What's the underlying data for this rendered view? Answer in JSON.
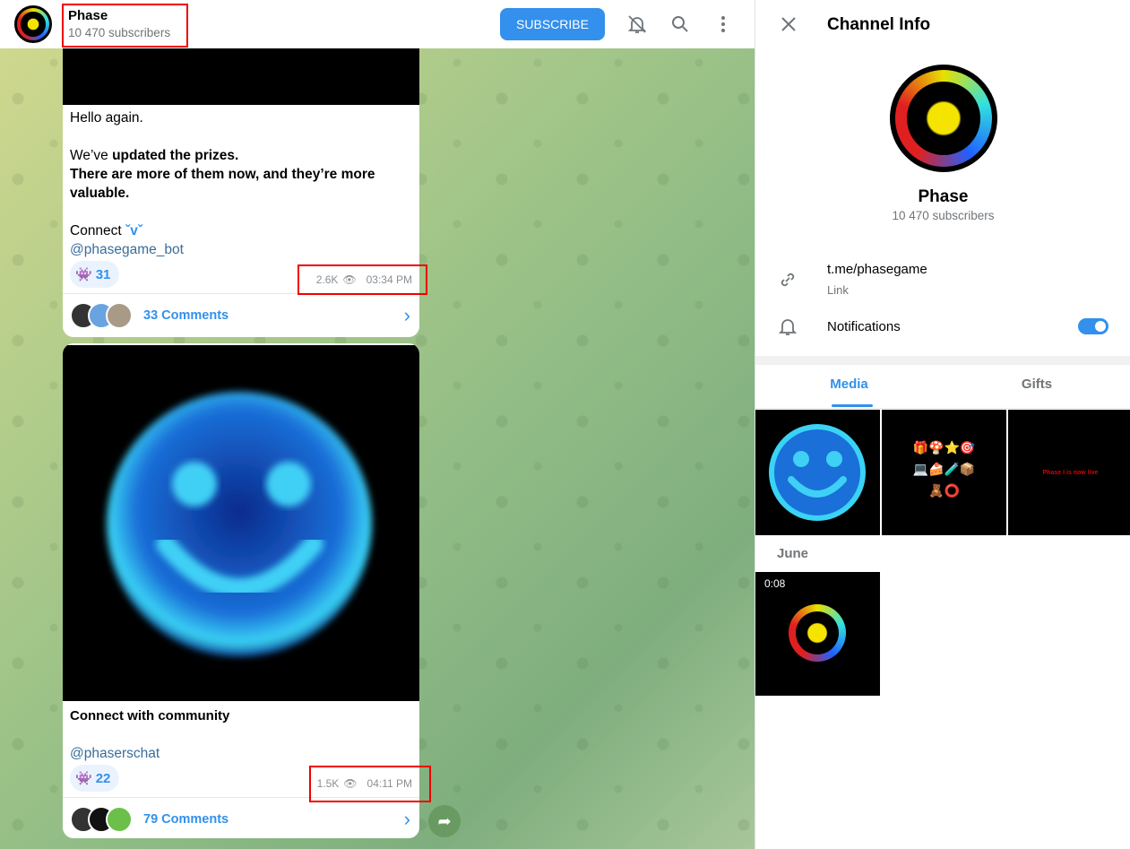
{
  "header": {
    "title": "Phase",
    "subscribers": "10 470 subscribers",
    "subscribe_label": "SUBSCRIBE"
  },
  "messages": [
    {
      "lines": [
        "Hello again."
      ],
      "bold_prefix": "We’ve ",
      "bold1": "updated the prizes.",
      "bold2": "There are more of them now, and they’re more valuable.",
      "connect": "Connect",
      "link": "@phasegame_bot",
      "reaction_count": "31",
      "views": "2.6K",
      "time": "03:34 PM",
      "comments": "33 Comments"
    },
    {
      "text": "Connect with community",
      "link": "@phaserschat",
      "reaction_count": "22",
      "views": "1.5K",
      "time": "04:11 PM",
      "comments": "79 Comments"
    }
  ],
  "panel": {
    "title": "Channel Info",
    "name": "Phase",
    "subscribers": "10 470 subscribers",
    "link": "t.me/phasegame",
    "link_label": "Link",
    "notifications": "Notifications",
    "notifications_on": true,
    "tabs": [
      "Media",
      "Gifts"
    ],
    "active_tab": "Media",
    "tile3_text": "Phase I is now live",
    "section": "June",
    "video_duration": "0:08"
  },
  "colors": {
    "accent": "#3390ec",
    "annotation": "#e00000"
  }
}
